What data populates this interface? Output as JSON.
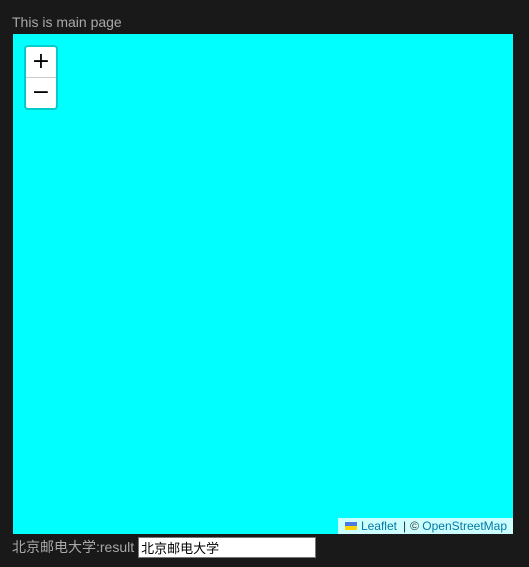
{
  "page": {
    "heading": "This is main page"
  },
  "map": {
    "background_color": "#00ffff",
    "zoom_in_label": "+",
    "zoom_out_label": "−",
    "attribution": {
      "leaflet_label": "Leaflet",
      "separator": "|",
      "copyright": "©",
      "osm_label": "OpenStreetMap",
      "flag_icon": "ukraine-flag-icon"
    }
  },
  "result": {
    "label": "北京邮电大学:result",
    "value": "北京邮电大学"
  }
}
